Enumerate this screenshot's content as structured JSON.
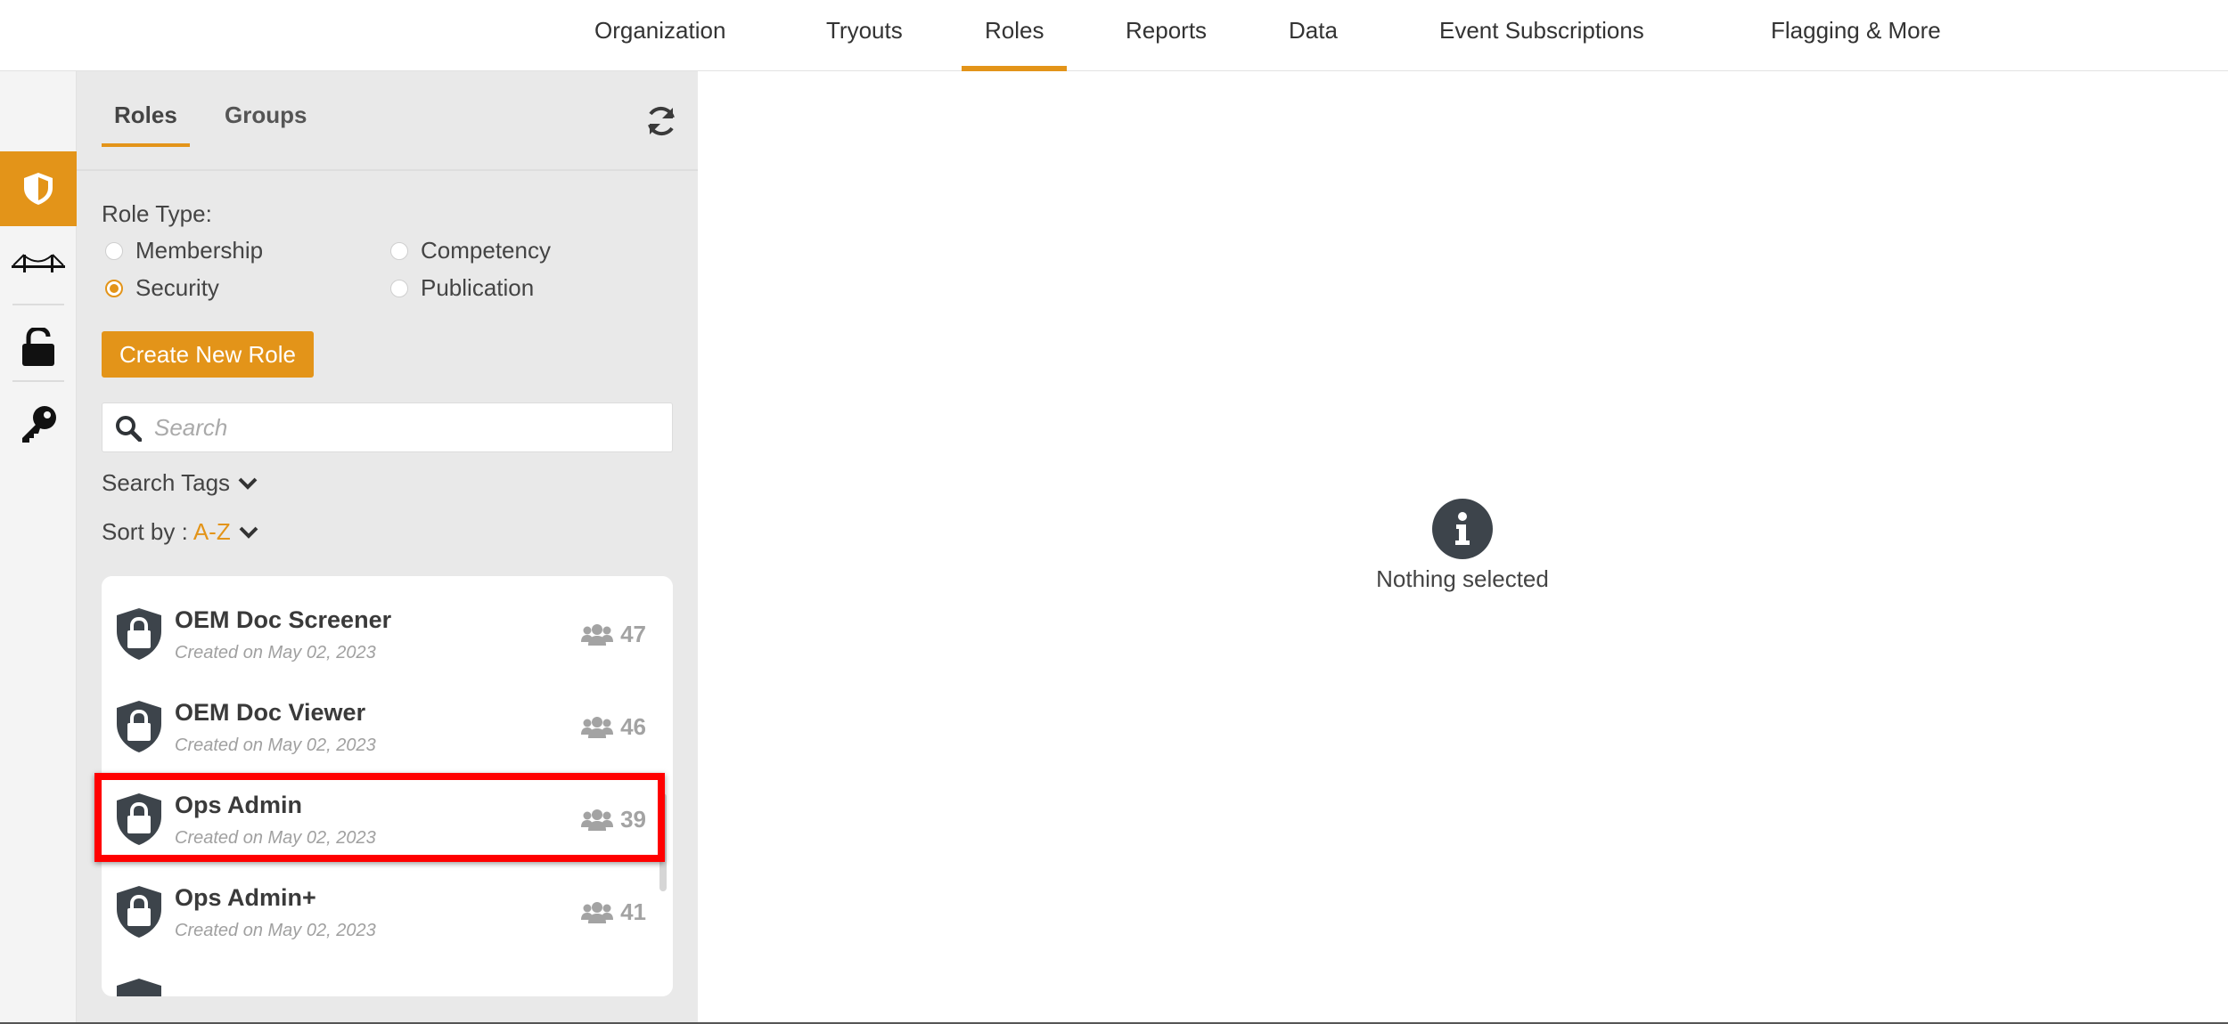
{
  "topnav": {
    "tabs": [
      {
        "label": "Organization"
      },
      {
        "label": "Tryouts"
      },
      {
        "label": "Roles"
      },
      {
        "label": "Reports"
      },
      {
        "label": "Data"
      },
      {
        "label": "Event Subscriptions"
      },
      {
        "label": "Flagging & More"
      }
    ],
    "active_tab": "Roles"
  },
  "rail": {
    "items": [
      "shield-icon",
      "bridge-icon",
      "unlock-icon",
      "key-icon"
    ],
    "active": "shield-icon"
  },
  "panel": {
    "tabs": [
      {
        "label": "Roles"
      },
      {
        "label": "Groups"
      }
    ],
    "active_tab": "Roles",
    "role_type_label": "Role Type:",
    "role_types": [
      {
        "label": "Membership",
        "checked": false
      },
      {
        "label": "Competency",
        "checked": false
      },
      {
        "label": "Security",
        "checked": true
      },
      {
        "label": "Publication",
        "checked": false
      }
    ],
    "create_label": "Create New Role",
    "search": {
      "placeholder": "Search",
      "value": ""
    },
    "search_tags_label": "Search Tags",
    "sort_label": "Sort by :",
    "sort_value": "A-Z",
    "roles": [
      {
        "name": "OEM Doc Screener",
        "created": "Created on May 02, 2023",
        "count": "47"
      },
      {
        "name": "OEM Doc Viewer",
        "created": "Created on May 02, 2023",
        "count": "46"
      },
      {
        "name": "Ops Admin",
        "created": "Created on May 02, 2023",
        "count": "39",
        "highlighted": true
      },
      {
        "name": "Ops Admin+",
        "created": "Created on May 02, 2023",
        "count": "41"
      }
    ]
  },
  "main": {
    "empty_text": "Nothing selected"
  },
  "colors": {
    "accent": "#e39419",
    "highlight": "#ff0000",
    "icon_dark": "#3d444b"
  }
}
